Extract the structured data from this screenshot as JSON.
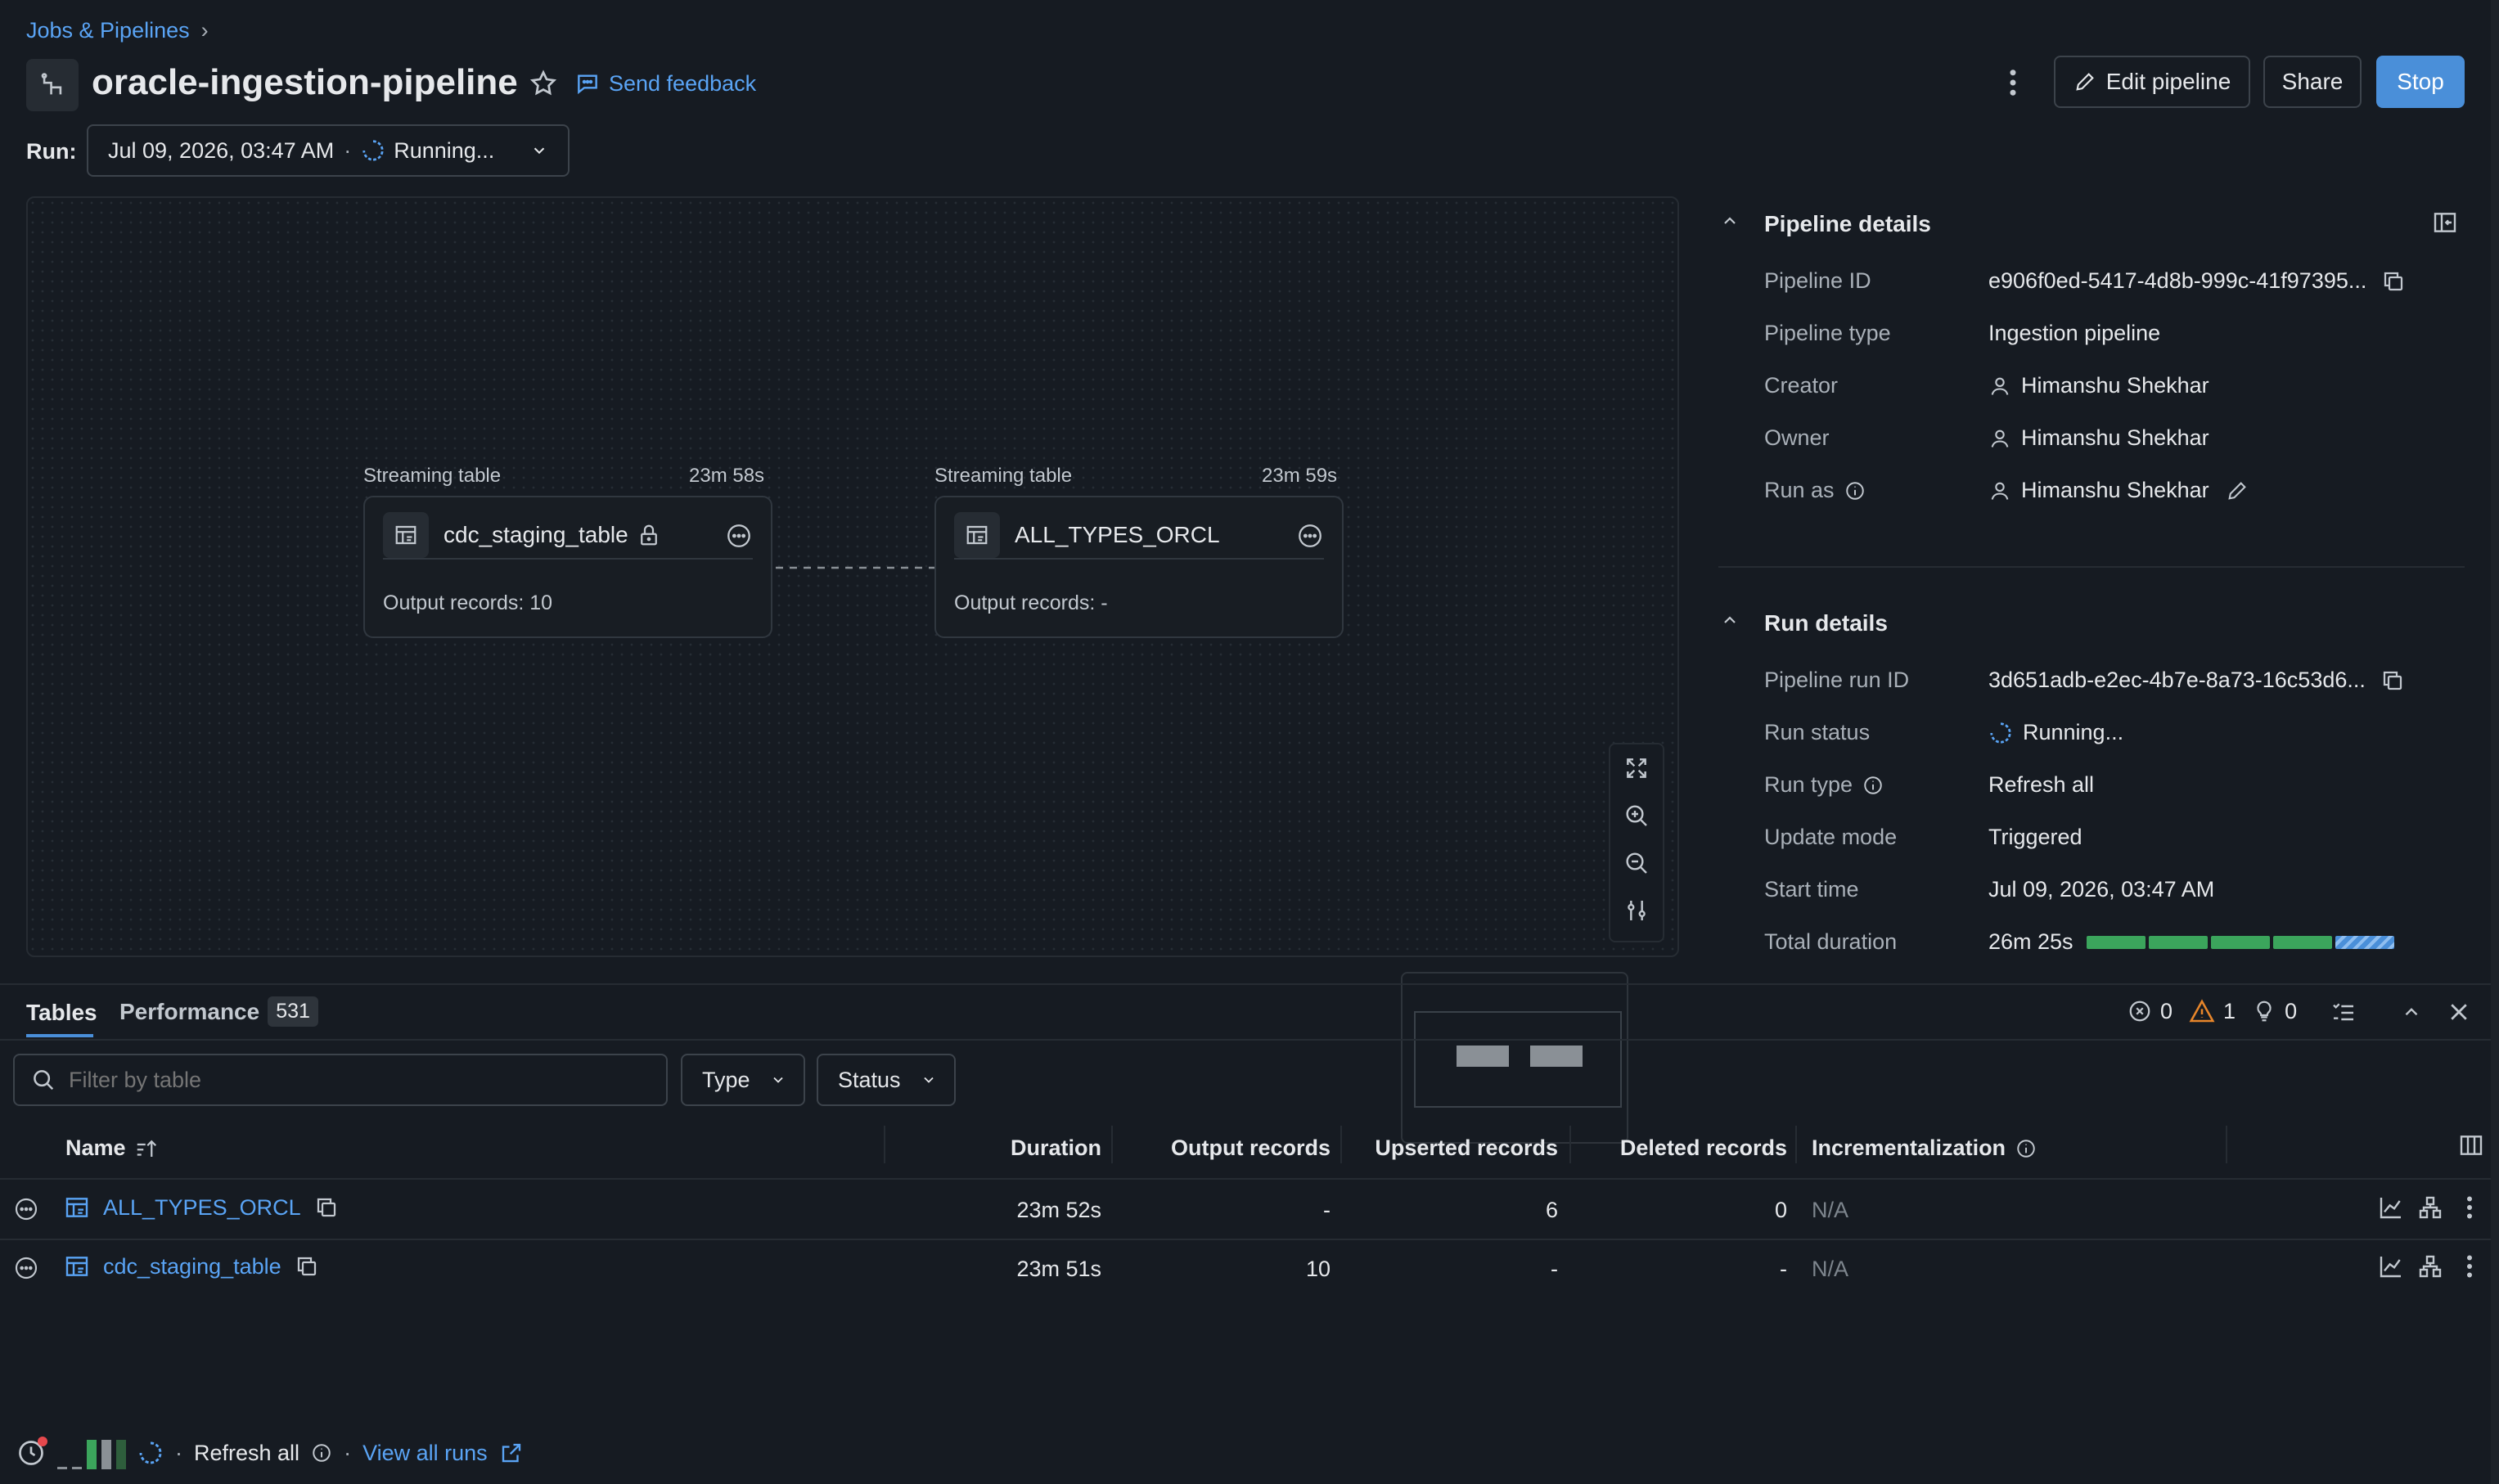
{
  "breadcrumb": {
    "parent": "Jobs & Pipelines",
    "separator": "›"
  },
  "header": {
    "title": "oracle-ingestion-pipeline",
    "feedback_label": "Send feedback",
    "edit_label": "Edit pipeline",
    "share_label": "Share",
    "stop_label": "Stop"
  },
  "run": {
    "label": "Run:",
    "date": "Jul 09, 2026, 03:47 AM",
    "dot": "·",
    "status": "Running..."
  },
  "graph": {
    "nodes": [
      {
        "type": "Streaming table",
        "duration": "23m 58s",
        "name": "cdc_staging_table",
        "output": "Output records: 10"
      },
      {
        "type": "Streaming table",
        "duration": "23m 59s",
        "name": "ALL_TYPES_ORCL",
        "output": "Output records: -"
      }
    ]
  },
  "pipeline_details": {
    "title": "Pipeline details",
    "rows": [
      {
        "key": "Pipeline ID",
        "value": "e906f0ed-5417-4d8b-999c-41f97395..."
      },
      {
        "key": "Pipeline type",
        "value": "Ingestion pipeline"
      },
      {
        "key": "Creator",
        "value": "Himanshu Shekhar"
      },
      {
        "key": "Owner",
        "value": "Himanshu Shekhar"
      },
      {
        "key": "Run as",
        "value": "Himanshu Shekhar"
      }
    ]
  },
  "run_details": {
    "title": "Run details",
    "rows": [
      {
        "key": "Pipeline run ID",
        "value": "3d651adb-e2ec-4b7e-8a73-16c53d6..."
      },
      {
        "key": "Run status",
        "value": "Running..."
      },
      {
        "key": "Run type",
        "value": "Refresh all"
      },
      {
        "key": "Update mode",
        "value": "Triggered"
      },
      {
        "key": "Start time",
        "value": "Jul 09, 2026, 03:47 AM"
      },
      {
        "key": "Total duration",
        "value": "26m 25s"
      }
    ]
  },
  "bottom_tabs": {
    "tables": "Tables",
    "performance": "Performance",
    "performance_count": "531"
  },
  "issues": {
    "errors": "0",
    "warnings": "1",
    "info": "0"
  },
  "filters": {
    "placeholder": "Filter by table",
    "type_label": "Type",
    "status_label": "Status"
  },
  "table": {
    "columns": {
      "name": "Name",
      "duration": "Duration",
      "output": "Output records",
      "upserted": "Upserted records",
      "deleted": "Deleted records",
      "incremental": "Incrementalization"
    },
    "rows": [
      {
        "name": "ALL_TYPES_ORCL",
        "duration": "23m 52s",
        "output": "-",
        "upserted": "6",
        "deleted": "0",
        "incremental": "N/A"
      },
      {
        "name": "cdc_staging_table",
        "duration": "23m 51s",
        "output": "10",
        "upserted": "-",
        "deleted": "-",
        "incremental": "N/A"
      }
    ]
  },
  "footer": {
    "dot": "·",
    "refresh": "Refresh all",
    "view_runs": "View all runs"
  },
  "colors": {
    "accent": "#4a8fd9",
    "link": "#5aa4f5",
    "success": "#3ba55c",
    "warning": "#e8862a",
    "error": "#e5484d"
  }
}
